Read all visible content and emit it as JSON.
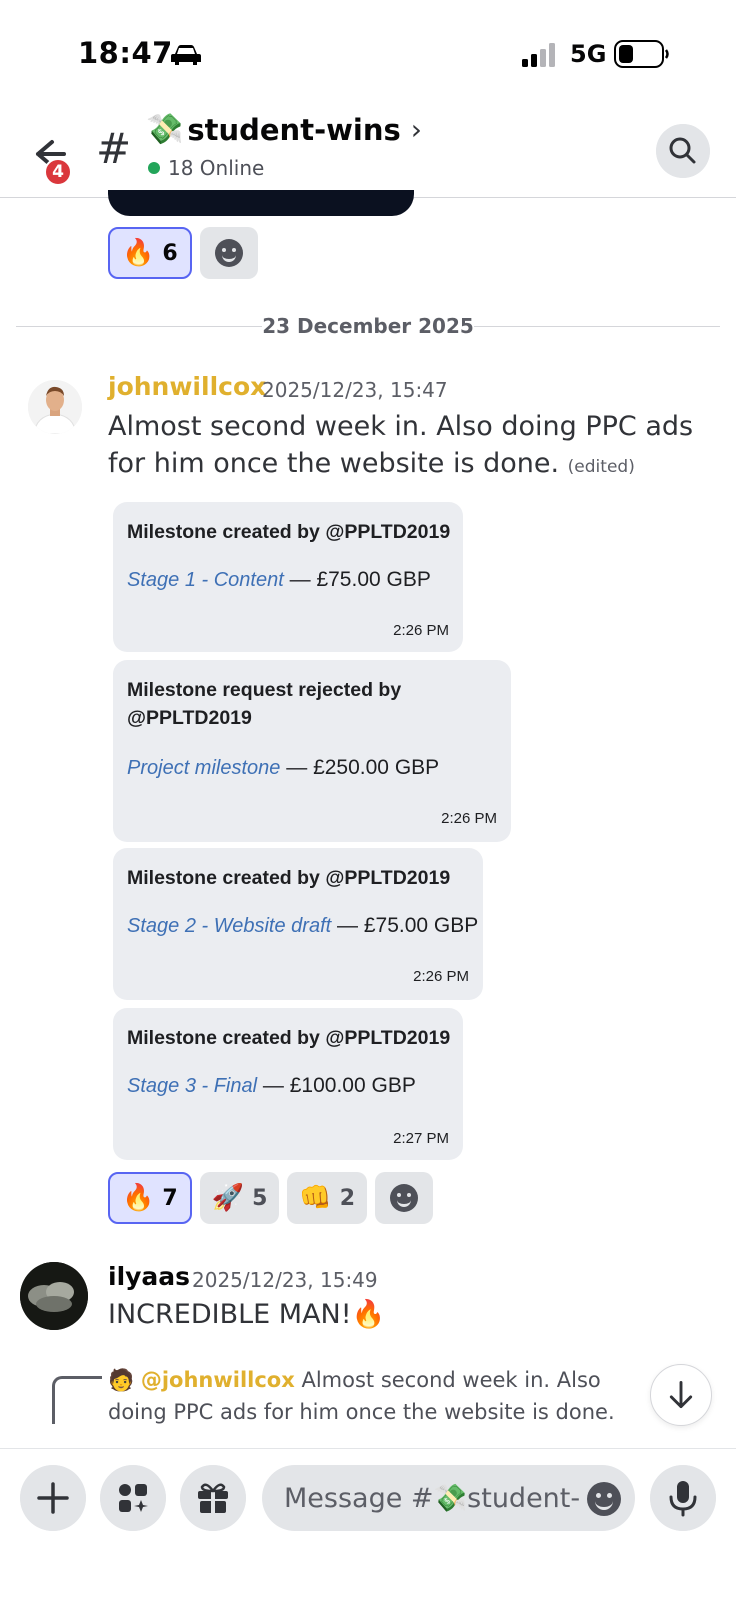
{
  "status_bar": {
    "time": "18:47",
    "network": "5G"
  },
  "header": {
    "unread_count": "4",
    "hash": "#",
    "channel_emoji": "💸",
    "channel_name": "student-wins",
    "chevron": "›",
    "online": "18 Online"
  },
  "top_reactions": [
    {
      "emoji": "🔥",
      "count": "6"
    }
  ],
  "date_divider": "23 December 2025",
  "message1": {
    "author": "johnwillcox",
    "author_color": "#e0b02e",
    "timestamp": "2025/12/23, 15:47",
    "text": "Almost second week in. Also doing PPC ads for him once the website is done.",
    "edited": "(edited)",
    "cards": [
      {
        "title": "Milestone created by @PPLTD2019",
        "link": "Stage 1 - Content",
        "amount": " — £75.00 GBP",
        "time": "2:26 PM"
      },
      {
        "title": "Milestone request rejected by @PPLTD2019",
        "link": "Project milestone",
        "amount": " — £250.00 GBP",
        "time": "2:26 PM"
      },
      {
        "title": "Milestone created by @PPLTD2019",
        "link": "Stage 2 - Website draft",
        "amount": " — £75.00 GBP",
        "time": "2:26 PM"
      },
      {
        "title": "Milestone created by @PPLTD2019",
        "link": "Stage 3 - Final",
        "amount": " — £100.00 GBP",
        "time": "2:27 PM"
      }
    ],
    "reactions": [
      {
        "emoji": "🔥",
        "count": "7"
      },
      {
        "emoji": "🚀",
        "count": "5"
      },
      {
        "emoji": "👊",
        "count": "2"
      }
    ]
  },
  "message2": {
    "author": "ilyaas",
    "timestamp": "2025/12/23, 15:49",
    "text": "INCREDIBLE MAN!🔥"
  },
  "reply_preview": {
    "mention": "@johnwillcox",
    "text": "Almost second week in. Also doing PPC ads for him once the website is done."
  },
  "composer": {
    "placeholder": "Message #💸student-..."
  },
  "colors": {
    "accent": "#5865f2",
    "online": "#23a55a",
    "badge": "#da373c",
    "link": "#3e70b5"
  }
}
